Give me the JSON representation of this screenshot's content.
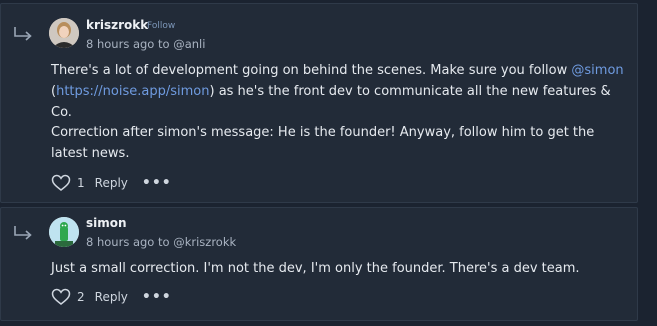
{
  "comments": [
    {
      "author": "kriszrokk",
      "follow_label": "Follow",
      "time": "8 hours ago",
      "to_prefix": "to",
      "reply_to": "@anli",
      "para1_before": "There's a lot of development going on behind the scenes. Make sure you follow ",
      "mention": "@simon",
      "para1_link_open": "(",
      "link": "https://noise.app/simon",
      "para1_after": ") as he's the front dev to communicate all the new features & Co.",
      "para2": "Correction after simon's message: He is the founder! Anyway, follow him to get the latest news.",
      "likes": "1",
      "reply_label": "Reply",
      "more_label": "•••"
    },
    {
      "author": "simon",
      "time": "8 hours ago",
      "to_prefix": "to",
      "reply_to": "@kriszrokk",
      "para1": "Just a small correction. I'm not the dev, I'm only the founder. There's a dev team.",
      "likes": "2",
      "reply_label": "Reply",
      "more_label": "•••"
    }
  ],
  "colors": {
    "background": "#1b2330",
    "card": "#222b38",
    "link": "#6f9be0",
    "follow": "#7d97b9"
  }
}
